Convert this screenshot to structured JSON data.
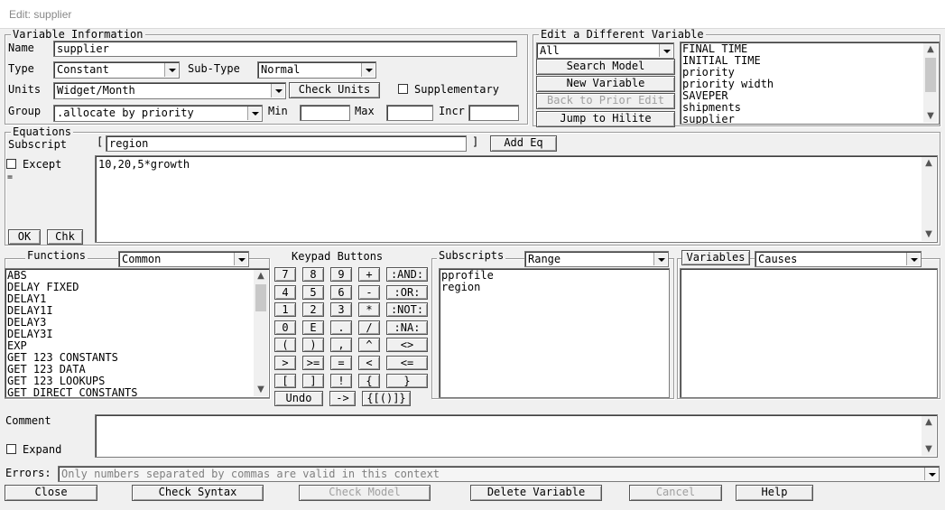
{
  "window": {
    "title": "Edit: supplier"
  },
  "variable_info": {
    "frame_title": "Variable Information",
    "name_label": "Name",
    "name_value": "supplier",
    "type_label": "Type",
    "type_value": "Constant",
    "subtype_label": "Sub-Type",
    "subtype_value": "Normal",
    "units_label": "Units",
    "units_value": "Widget/Month",
    "check_units": "Check Units",
    "supplementary_label": "Supplementary",
    "group_label": "Group",
    "group_value": ".allocate by priority",
    "min_label": "Min",
    "max_label": "Max",
    "incr_label": "Incr"
  },
  "edit_different": {
    "frame_title": "Edit a Different Variable",
    "filter_value": "All",
    "search_model": "Search Model",
    "new_variable": "New Variable",
    "back_to_prior": "Back to Prior Edit",
    "jump_to_hilite": "Jump to Hilite",
    "variables": [
      "FINAL TIME",
      "INITIAL TIME",
      "priority",
      "priority width",
      "SAVEPER",
      "shipments",
      "supplier"
    ]
  },
  "equations": {
    "frame_title": "Equations",
    "subscript_label": "Subscript",
    "open_bracket": "[",
    "subscript_value": "region",
    "close_bracket": "]",
    "add_eq": "Add Eq",
    "except_label": "Except",
    "equals": "=",
    "equation_text": "10,20,5*growth",
    "ok": "OK",
    "chk": "Chk"
  },
  "functions": {
    "title": "Functions",
    "filter_value": "Common",
    "items": [
      "ABS",
      "DELAY FIXED",
      "DELAY1",
      "DELAY1I",
      "DELAY3",
      "DELAY3I",
      "EXP",
      "GET 123 CONSTANTS",
      "GET 123 DATA",
      "GET 123 LOOKUPS",
      "GET DIRECT CONSTANTS"
    ]
  },
  "keypad": {
    "title": "Keypad Buttons",
    "rows": [
      [
        "7",
        "8",
        "9",
        "+",
        ":AND:"
      ],
      [
        "4",
        "5",
        "6",
        "-",
        ":OR:"
      ],
      [
        "1",
        "2",
        "3",
        "*",
        ":NOT:"
      ],
      [
        "0",
        "E",
        ".",
        "/",
        ":NA:"
      ],
      [
        "(",
        ")",
        ",",
        "^",
        "<>"
      ],
      [
        ">",
        ">=",
        "=",
        "<",
        "<="
      ],
      [
        "[",
        "]",
        "!",
        "{",
        "}"
      ]
    ],
    "undo": "Undo",
    "arrow": "->",
    "brackets": "{[()]}"
  },
  "subscripts": {
    "title": "Subscripts",
    "filter_value": "Range",
    "items": [
      "pprofile",
      "region"
    ]
  },
  "variables_panel": {
    "button": "Variables",
    "filter_value": "Causes",
    "items": []
  },
  "comment": {
    "label": "Comment",
    "expand_label": "Expand",
    "value": ""
  },
  "errors": {
    "label": "Errors:",
    "value": "Only numbers separated by commas are valid in this context"
  },
  "bottom_buttons": {
    "close": "Close",
    "check_syntax": "Check Syntax",
    "check_model": "Check Model",
    "delete_variable": "Delete Variable",
    "cancel": "Cancel",
    "help": "Help"
  }
}
